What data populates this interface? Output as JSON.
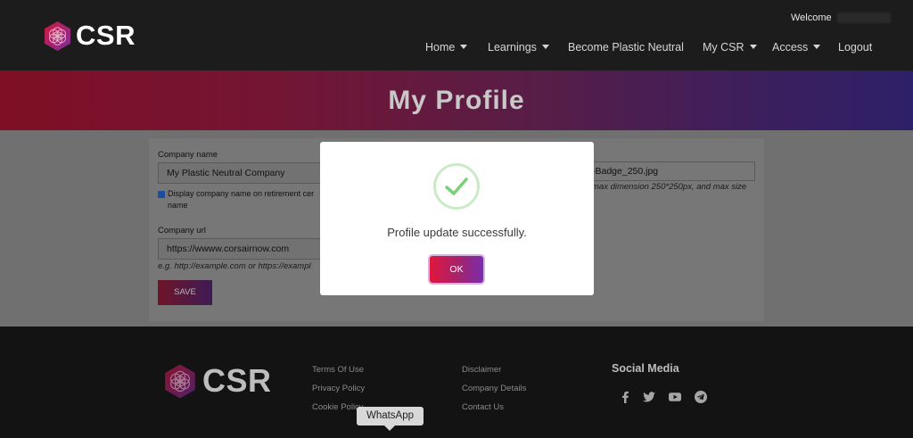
{
  "header": {
    "logo_text": "CSR",
    "welcome_label": "Welcome",
    "nav": [
      {
        "label": "Home",
        "has_caret": true
      },
      {
        "label": "Learnings",
        "has_caret": true
      },
      {
        "label": "Become Plastic Neutral",
        "has_caret": false
      },
      {
        "label": "My CSR",
        "has_caret": true
      },
      {
        "label": "Access",
        "has_caret": true
      },
      {
        "label": "Logout",
        "has_caret": false
      }
    ]
  },
  "banner": {
    "title": "My Profile"
  },
  "form": {
    "company_name_label": "Company name",
    "company_name_value": "My Plastic Neutral Company",
    "display_checkbox_line1": "Display company name on retirement cer",
    "display_checkbox_line2": "name",
    "company_url_label": "Company url",
    "company_url_value": "https://wwww.corsairnow.com",
    "company_url_hint": "e.g. http://example.com or https://exampl",
    "save_label": "SAVE",
    "badge_file_name": "-Badge_250.jpg",
    "badge_hint": "max dimension 250*250px, and max size"
  },
  "modal": {
    "message": "Profile update successfully.",
    "ok_label": "OK",
    "icon": "check-icon"
  },
  "footer": {
    "logo_text": "CSR",
    "links_col1": [
      "Terms Of Use",
      "Privacy Policy",
      "Cookie Policy"
    ],
    "links_col2": [
      "Disclaimer",
      "Company Details",
      "Contact Us"
    ],
    "social_title": "Social Media",
    "social_icons": [
      "facebook-icon",
      "twitter-icon",
      "youtube-icon",
      "telegram-icon"
    ]
  },
  "tooltip": {
    "label": "WhatsApp"
  },
  "colors": {
    "ok_gradient_start": "#e0173e",
    "ok_gradient_end": "#7a2dac",
    "success_check": "#7dcf78"
  }
}
